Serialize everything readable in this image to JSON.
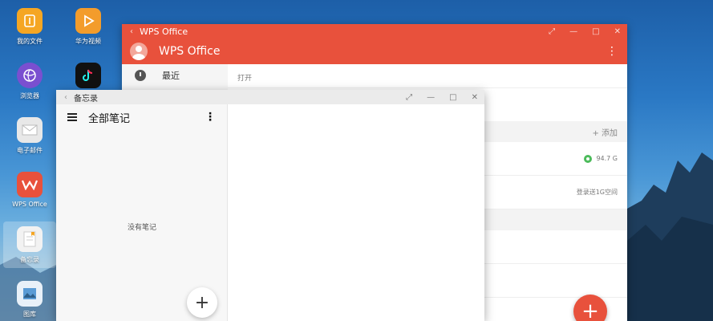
{
  "desktop": {
    "icons": [
      {
        "label": "我的文件",
        "icon": "folder-icon",
        "color": "#f5a623"
      },
      {
        "label": "华为视频",
        "icon": "play-icon",
        "color": "#f39c2b"
      },
      {
        "label": "浏览器",
        "icon": "browser-icon",
        "color": "#7a4fd0"
      },
      {
        "label": "tiktok",
        "icon": "tiktok-icon",
        "color": "#111111"
      },
      {
        "label": "电子邮件",
        "icon": "mail-icon",
        "color": "#e8e8e8"
      },
      {
        "label": "WPS Office",
        "icon": "wps-icon",
        "color": "#e8513c"
      },
      {
        "label": "备忘录",
        "icon": "notes-icon",
        "color": "#f2f2f2"
      },
      {
        "label": "图库",
        "icon": "gallery-icon",
        "color": "#e8f0f8"
      }
    ]
  },
  "wps": {
    "window_title": "WPS Office",
    "header_title": "WPS Office",
    "sidebar": {
      "recent": "最近"
    },
    "open_label": "打开",
    "add_label": "+ 添加",
    "storage": "94.7 G",
    "login_hint": "登录送1G空间",
    "accent": "#e8513c"
  },
  "memo": {
    "window_title": "备忘录",
    "header_title": "全部笔记",
    "empty_text": "没有笔记"
  }
}
